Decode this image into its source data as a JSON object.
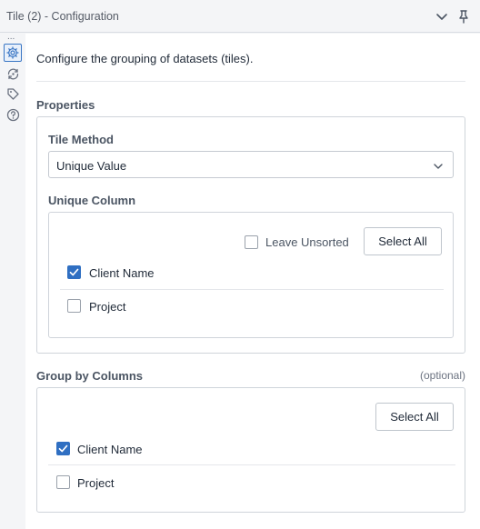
{
  "window": {
    "title": "Tile (2) - Configuration",
    "collapse_icon": "chevron-down-icon",
    "pin_icon": "pin-icon"
  },
  "rail": {
    "overflow": "...",
    "items": [
      {
        "icon": "gear-icon",
        "active": true
      },
      {
        "icon": "connection-icon",
        "active": false
      },
      {
        "icon": "tag-icon",
        "active": false
      },
      {
        "icon": "help-icon",
        "active": false
      }
    ]
  },
  "description": "Configure the grouping of datasets (tiles).",
  "properties": {
    "label": "Properties",
    "tile_method": {
      "label": "Tile Method",
      "value": "Unique Value"
    },
    "unique_column": {
      "label": "Unique Column",
      "leave_unsorted_label": "Leave Unsorted",
      "leave_unsorted_checked": false,
      "select_all_label": "Select All",
      "columns": [
        {
          "name": "Client Name",
          "checked": true
        },
        {
          "name": "Project",
          "checked": false
        }
      ]
    }
  },
  "group_by": {
    "label": "Group by Columns",
    "optional_label": "(optional)",
    "select_all_label": "Select All",
    "columns": [
      {
        "name": "Client Name",
        "checked": true
      },
      {
        "name": "Project",
        "checked": false
      }
    ]
  },
  "colors": {
    "accent": "#2f6fc2",
    "border": "#cfd4da",
    "background": "#f4f5f7"
  }
}
